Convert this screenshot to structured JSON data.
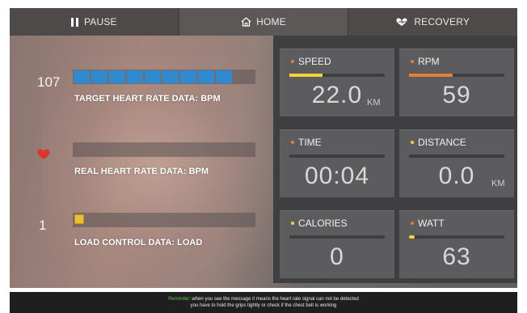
{
  "nav": {
    "pause": "PAUSE",
    "home": "HOME",
    "recovery": "RECOVERY"
  },
  "heart": {
    "target_value": "107",
    "target_label": "TARGET HEART RATE DATA: BPM",
    "target_segments": 9,
    "real_label": "REAL HEART RATE DATA: BPM",
    "load_value": "1",
    "load_label": "LOAD CONTROL DATA: LOAD"
  },
  "metrics": {
    "speed": {
      "title": "SPEED",
      "value": "22.0",
      "unit": "KM",
      "level": 0.35
    },
    "rpm": {
      "title": "RPM",
      "value": "59",
      "unit": "",
      "level": 0.46
    },
    "time": {
      "title": "TIME",
      "value": "00:04",
      "unit": "",
      "level": 0
    },
    "distance": {
      "title": "DISTANCE",
      "value": "0.0",
      "unit": "KM",
      "level": 0
    },
    "calories": {
      "title": "CALORIES",
      "value": "0",
      "unit": "",
      "level": 0
    },
    "watt": {
      "title": "WATT",
      "value": "63",
      "unit": "",
      "level": 0.03
    }
  },
  "colors": {
    "accent_orange": "#e2803a",
    "accent_yellow": "#f3d23a",
    "target_blue": "#2f8ad0",
    "load_yellow": "#e9c03a",
    "heart_red": "#d9362e",
    "reminder_green": "#5fc24a"
  },
  "footer": {
    "keyword": "Reminder",
    "line1": ": when you see the message it means the heart rate signal can not be detected",
    "line2": "you have to hold the grips tightly or check if the chest belt is working"
  }
}
